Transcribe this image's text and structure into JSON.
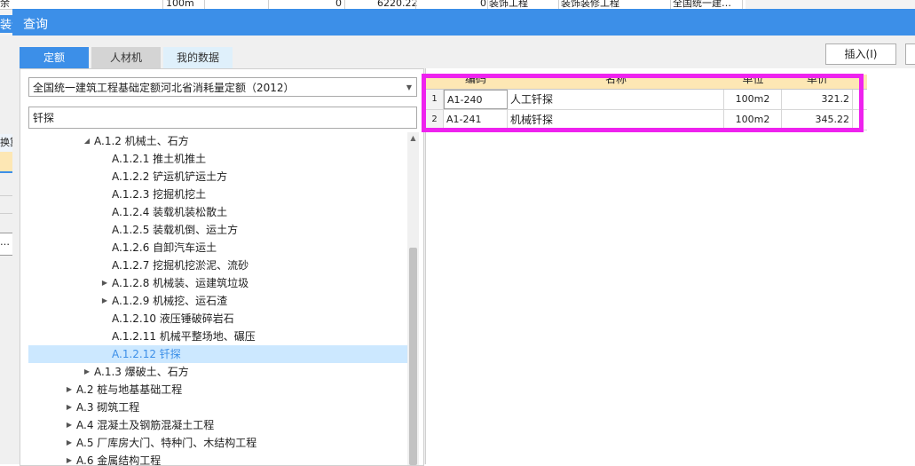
{
  "background": {
    "top_row": [
      "余",
      "100m",
      "0",
      "6220.22",
      "0",
      "装饰工程",
      "装饰装修工程",
      "全国统一建…"
    ],
    "left_label": "装饰",
    "left_fragments": [
      "换算",
      "…"
    ]
  },
  "dialog": {
    "title": "查询",
    "tabs": [
      "定额",
      "人材机",
      "我的数据"
    ],
    "insert_button": "插入(I)",
    "quota_library": "全国统一建筑工程基础定额河北省消耗量定额（2012）",
    "search_value": "钎探",
    "tree": [
      {
        "label": "A.1.2 机械土、石方",
        "expander": "◢",
        "level": 2
      },
      {
        "label": "A.1.2.1 推土机推土",
        "expander": "",
        "level": 3
      },
      {
        "label": "A.1.2.2 铲运机铲运土方",
        "expander": "",
        "level": 3
      },
      {
        "label": "A.1.2.3 挖掘机挖土",
        "expander": "",
        "level": 3
      },
      {
        "label": "A.1.2.4 装载机装松散土",
        "expander": "",
        "level": 3
      },
      {
        "label": "A.1.2.5 装载机倒、运土方",
        "expander": "",
        "level": 3
      },
      {
        "label": "A.1.2.6 自卸汽车运土",
        "expander": "",
        "level": 3
      },
      {
        "label": "A.1.2.7 挖掘机挖淤泥、流砂",
        "expander": "",
        "level": 3
      },
      {
        "label": "A.1.2.8 机械装、运建筑垃圾",
        "expander": "▶",
        "level": 3
      },
      {
        "label": "A.1.2.9 机械挖、运石渣",
        "expander": "▶",
        "level": 3
      },
      {
        "label": "A.1.2.10 液压锤破碎岩石",
        "expander": "",
        "level": 3
      },
      {
        "label": "A.1.2.11 机械平整场地、碾压",
        "expander": "",
        "level": 3
      },
      {
        "label": "A.1.2.12 钎探",
        "expander": "",
        "level": 3,
        "selected": true
      },
      {
        "label": "A.1.3 爆破土、石方",
        "expander": "▶",
        "level": 2
      },
      {
        "label": "A.2 桩与地基基础工程",
        "expander": "▶",
        "level": 1
      },
      {
        "label": "A.3 砌筑工程",
        "expander": "▶",
        "level": 1
      },
      {
        "label": "A.4 混凝土及钢筋混凝土工程",
        "expander": "▶",
        "level": 1
      },
      {
        "label": "A.5 厂库房大门、特种门、木结构工程",
        "expander": "▶",
        "level": 1
      },
      {
        "label": "A.6 金属结构工程",
        "expander": "▶",
        "level": 1
      }
    ],
    "grid": {
      "headers": [
        "编码",
        "名称",
        "单位",
        "单价"
      ],
      "rows": [
        {
          "num": "1",
          "code": "A1-240",
          "name": "人工钎探",
          "unit": "100m2",
          "price": "321.2"
        },
        {
          "num": "2",
          "code": "A1-241",
          "name": "机械钎探",
          "unit": "100m2",
          "price": "345.22"
        }
      ]
    }
  },
  "colors": {
    "title_bar": "#3c8fe8",
    "selected_row": "#cce8ff",
    "grid_header": "#fde7b4",
    "annotation_box": "#ee22ee"
  }
}
